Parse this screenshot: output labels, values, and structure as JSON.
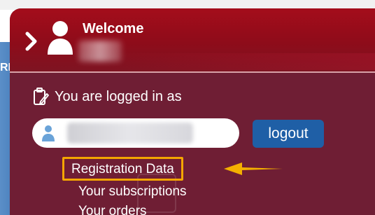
{
  "background": {
    "top_fragment": "",
    "left_fragment": "RE"
  },
  "header": {
    "welcome": "Welcome"
  },
  "account": {
    "logged_in_label": "You are logged in as",
    "logout_label": "logout"
  },
  "menu": {
    "items": [
      {
        "label": "Registration Data"
      },
      {
        "label": "Your subscriptions"
      },
      {
        "label": "Your orders"
      }
    ]
  },
  "colors": {
    "panel": "#6f1e34",
    "header": "#a40d1b",
    "logout_button": "#1f5fa6",
    "highlight": "#f4a600"
  }
}
